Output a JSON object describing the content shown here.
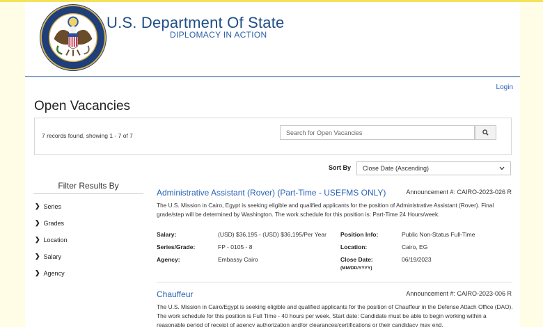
{
  "header": {
    "title": "U.S. Department Of State",
    "subtitle": "DIPLOMACY IN ACTION",
    "seal_text": "DEPARTMENT OF STATE · UNITED STATES OF AMERICA"
  },
  "nav": {
    "login": "Login"
  },
  "page_title": "Open Vacancies",
  "search": {
    "records_text": "7 records found, showing 1 - 7 of 7",
    "placeholder": "Search for Open Vacancies",
    "button_icon": "search-icon"
  },
  "sort": {
    "label": "Sort By",
    "selected": "Close Date (Ascending)"
  },
  "filters": {
    "title": "Filter Results By",
    "items": [
      "Series",
      "Grades",
      "Location",
      "Salary",
      "Agency"
    ]
  },
  "jobs": [
    {
      "title": "Administrative Assistant (Rover) (Part-Time - USEFMS ONLY)",
      "announcement": "Announcement #: CAIRO-2023-026 R",
      "description": "The U.S. Mission in Cairo, Egypt is seeking eligible and qualified applicants for the position of Administrative Assistant (Rover). Final grade/step will be determined by Washington. The work schedule for this position is: Part-Time 24 Hours/week.",
      "salary_label": "Salary:",
      "salary": "(USD) $36,195 - (USD) $36,195/Per Year",
      "series_label": "Series/Grade:",
      "series": "FP - 0105 - 8",
      "agency_label": "Agency:",
      "agency": "Embassy Cairo",
      "position_label": "Position Info:",
      "position": "Public Non-Status Full-Time",
      "location_label": "Location:",
      "location": "Cairo, EG",
      "close_label": "Close Date:",
      "close_format": "(MM/DD/YYYY)",
      "close_date": "06/19/2023"
    },
    {
      "title": "Chauffeur",
      "announcement": "Announcement #: CAIRO-2023-006 R",
      "description": "The U.S. Mission in Cairo/Egypt is seeking eligible and qualified applicants for the position of Chauffeur in the Defense Attach Office (DAO). The work schedule for this position is Full Time - 40 hours per week. Start date: Candidate must be able to begin working within a reasonable period of receipt of agency authorization and/or clearances/certifications or their candidacy may end."
    }
  ],
  "colors": {
    "brand_blue": "#1f4e86",
    "link_blue": "#2a62b8",
    "frame_yellow": "#f4e35a"
  }
}
